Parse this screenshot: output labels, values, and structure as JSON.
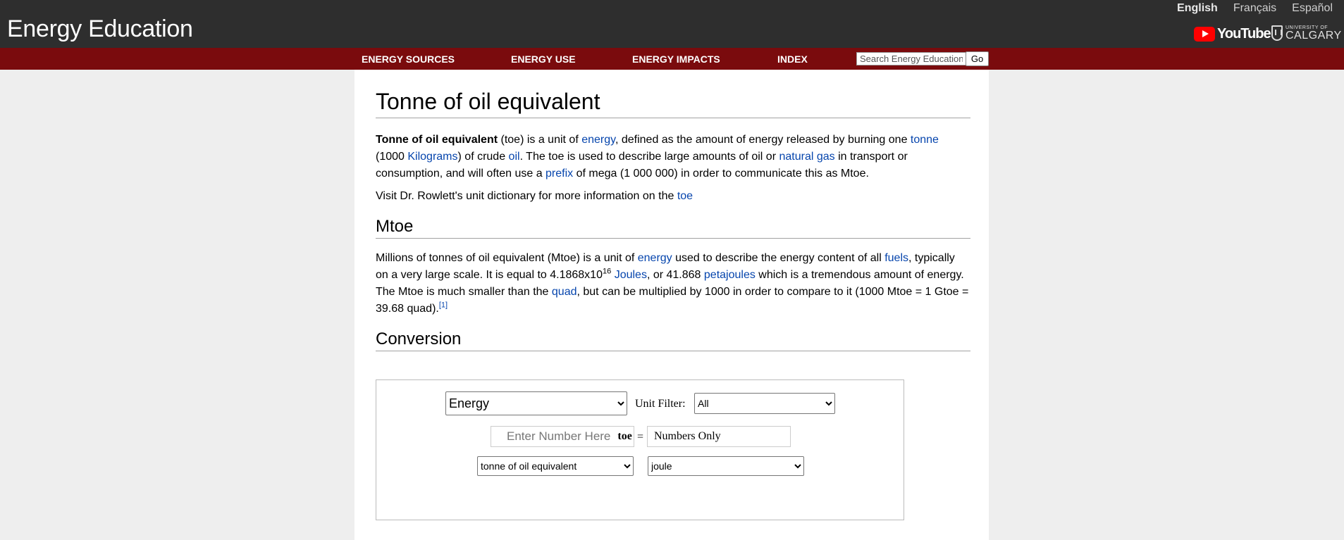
{
  "header": {
    "site_title": "Energy Education",
    "languages": [
      "English",
      "Français",
      "Español"
    ],
    "youtube_label": "YouTube",
    "university_small": "UNIVERSITY OF",
    "university_big": "CALGARY"
  },
  "nav": {
    "items": [
      "ENERGY SOURCES",
      "ENERGY USE",
      "ENERGY IMPACTS",
      "INDEX"
    ],
    "search_placeholder": "Search Energy Education",
    "go_label": "Go"
  },
  "article": {
    "title": "Tonne of oil equivalent",
    "intro": {
      "bold": "Tonne of oil equivalent",
      "t1": " (toe) is a unit of ",
      "l1": "energy",
      "t2": ", defined as the amount of energy released by burning one ",
      "l2": "tonne",
      "t3": " (1000 ",
      "l3": "Kilograms",
      "t4": ") of crude ",
      "l4": "oil",
      "t5": ". The toe is used to describe large amounts of oil or ",
      "l5": "natural gas",
      "t6": " in transport or consumption, and will often use a ",
      "l6": "prefix",
      "t7": " of mega (1 000 000) in order to communicate this as Mtoe."
    },
    "visit": {
      "text": "Visit Dr. Rowlett's unit dictionary for more information on the ",
      "link": "toe"
    },
    "mtoe_heading": "Mtoe",
    "mtoe": {
      "t1": "Millions of tonnes of oil equivalent (Mtoe) is a unit of ",
      "l1": "energy",
      "t2": " used to describe the energy content of all ",
      "l2": "fuels",
      "t3": ", typically on a very large scale. It is equal to 4.1868x10",
      "sup": "16",
      "t4": " ",
      "l3": "Joules",
      "t5": ", or 41.868 ",
      "l4": "petajoules",
      "t6": " which is a tremendous amount of energy. The Mtoe is much smaller than the ",
      "l5": "quad",
      "t7": ", but can be multiplied by 1000 in order to compare to it (1000 Mtoe = 1 Gtoe = 39.68 quad).",
      "ref": "[1]"
    },
    "conversion_heading": "Conversion"
  },
  "converter": {
    "category_value": "Energy",
    "unit_filter_label": "Unit Filter:",
    "filter_value": "All",
    "input_placeholder": "Enter Number Here",
    "input_unit": "toe",
    "equals": "=",
    "result_text": "Numbers Only",
    "from_unit": "tonne of oil equivalent",
    "to_unit": "joule"
  }
}
